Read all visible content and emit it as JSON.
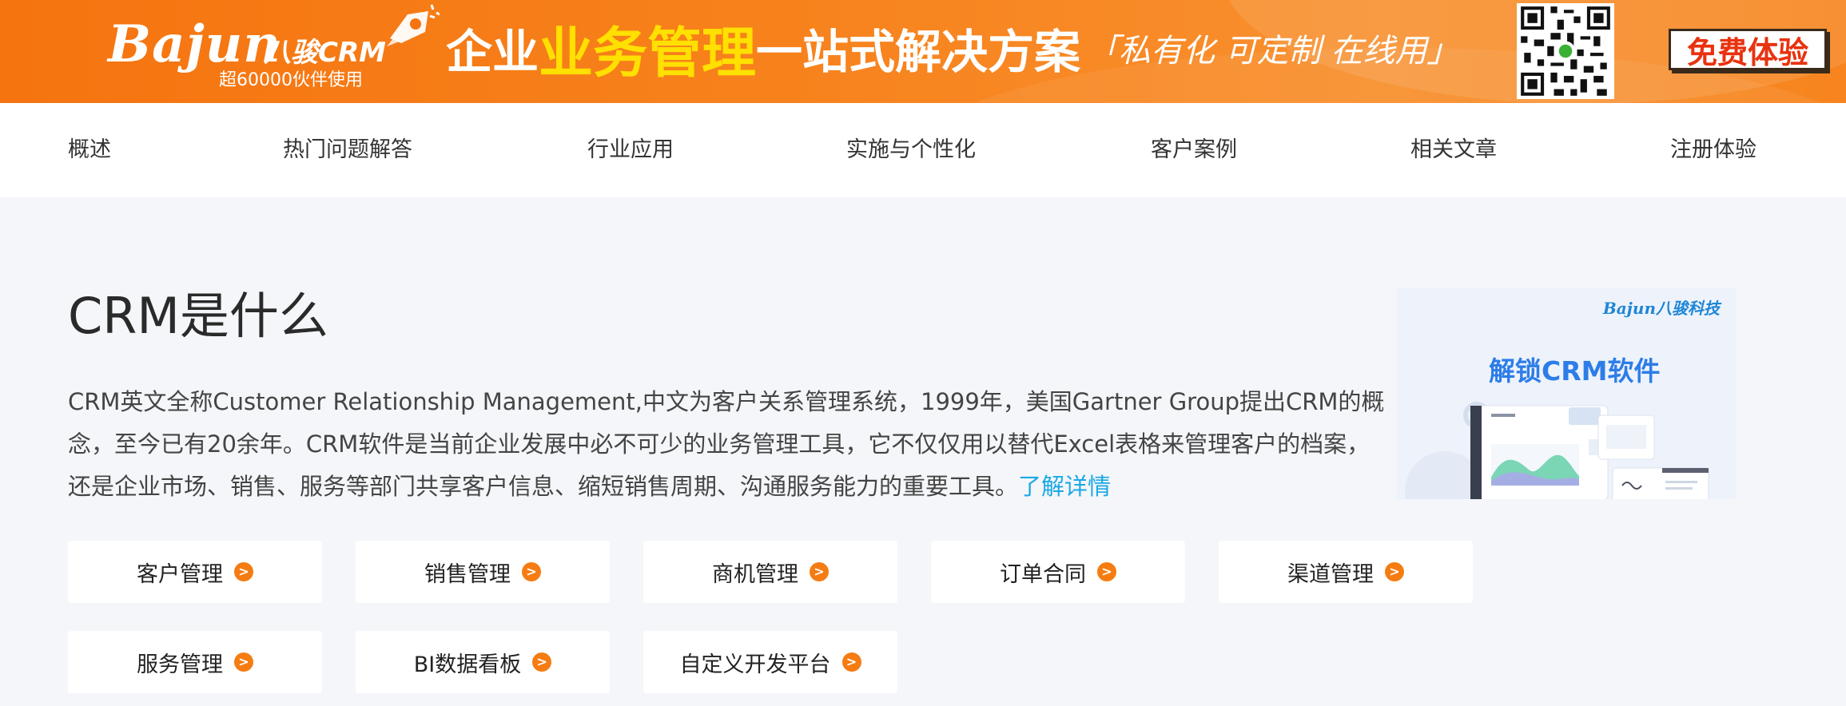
{
  "banner": {
    "logo_text": "Bajun",
    "logo_cn": "八骏CRM",
    "logo_sub": "超60000伙伴使用",
    "slogan_part1": "企业",
    "slogan_highlight": "业务管理",
    "slogan_part2": "一站式解决方案",
    "slogan_tag": "「私有化 可定制 在线用」",
    "free_trial_label": "免费体验",
    "accent_color": "#f7811b",
    "highlight_color": "#ffe000"
  },
  "nav": {
    "items": [
      "概述",
      "热门问题解答",
      "行业应用",
      "实施与个性化",
      "客户案例",
      "相关文章",
      "注册体验"
    ]
  },
  "main": {
    "title": "CRM是什么",
    "description": "CRM英文全称Customer Relationship Management,中文为客户关系管理系统，1999年，美国Gartner Group提出CRM的概念，至今已有20余年。CRM软件是当前企业发展中必不可少的业务管理工具，它不仅仅用以替代Excel表格来管理客户的档案，还是企业市场、销售、服务等部门共享客户信息、缩短销售周期、沟通服务能力的重要工具。",
    "more_link": "了解详情",
    "promo": {
      "brand": "Bajun八骏科技",
      "title": "解锁CRM软件"
    }
  },
  "modules": [
    {
      "label": "客户管理"
    },
    {
      "label": "销售管理"
    },
    {
      "label": "商机管理"
    },
    {
      "label": "订单合同"
    },
    {
      "label": "渠道管理"
    },
    {
      "label": "服务管理"
    },
    {
      "label": "BI数据看板"
    },
    {
      "label": "自定义开发平台"
    }
  ],
  "module_arrow_icon": "chevron-right-circle-icon",
  "arrow_glyph": ">"
}
